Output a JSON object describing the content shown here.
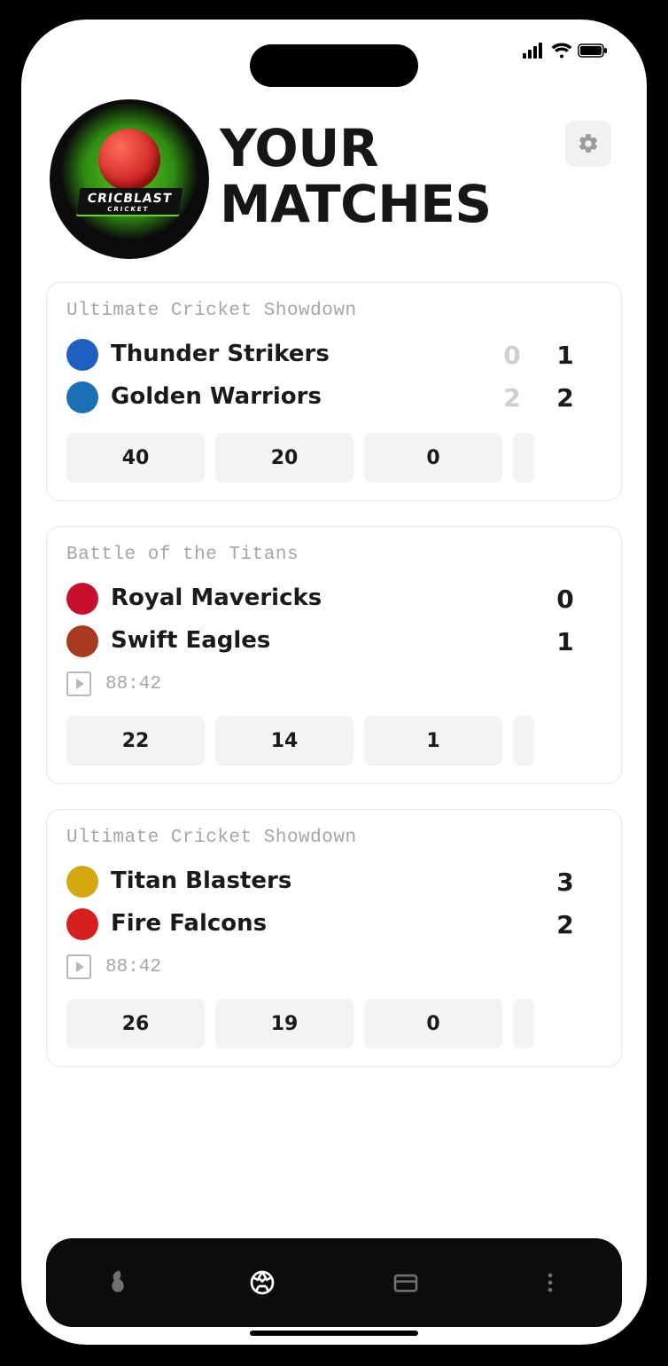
{
  "app_logo_text": "CRICBLAST",
  "app_logo_subtext": "CRICKET",
  "page_title": "YOUR MATCHES",
  "matches": [
    {
      "tournament": "Ultimate Cricket Showdown",
      "show_previous_scores": true,
      "teams": [
        {
          "name": "Thunder Strikers",
          "prev_score": "0",
          "score": "1",
          "logo_color": "#1e5fbf"
        },
        {
          "name": "Golden Warriors",
          "prev_score": "2",
          "score": "2",
          "logo_color": "#1a6fb5"
        }
      ],
      "time": null,
      "chips": [
        "40",
        "20",
        "0"
      ]
    },
    {
      "tournament": "Battle of the Titans",
      "show_previous_scores": false,
      "teams": [
        {
          "name": "Royal Mavericks",
          "score": "0",
          "logo_color": "#c8102e"
        },
        {
          "name": "Swift Eagles",
          "score": "1",
          "logo_color": "#a73a1f"
        }
      ],
      "time": "88:42",
      "chips": [
        "22",
        "14",
        "1"
      ]
    },
    {
      "tournament": "Ultimate Cricket Showdown",
      "show_previous_scores": false,
      "teams": [
        {
          "name": "Titan Blasters",
          "score": "3",
          "logo_color": "#d6a80f"
        },
        {
          "name": "Fire Falcons",
          "score": "2",
          "logo_color": "#d61f1f"
        }
      ],
      "time": "88:42",
      "chips": [
        "26",
        "19",
        "0"
      ]
    }
  ],
  "dock": {
    "items": [
      "fire",
      "ball",
      "card",
      "more"
    ],
    "active": "ball"
  }
}
